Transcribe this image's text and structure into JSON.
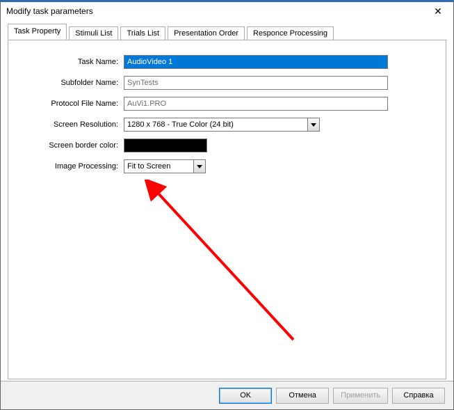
{
  "window": {
    "title": "Modify task parameters"
  },
  "tabs": {
    "items": [
      {
        "label": "Task Property"
      },
      {
        "label": "Stimuli List"
      },
      {
        "label": "Trials List"
      },
      {
        "label": "Presentation Order"
      },
      {
        "label": "Responce Processing"
      }
    ],
    "active_index": 0
  },
  "form": {
    "task_name": {
      "label": "Task Name:",
      "value": "AudioVideo 1"
    },
    "subfolder": {
      "label": "Subfolder Name:",
      "value": "SynTests"
    },
    "protocol": {
      "label": "Protocol File Name:",
      "value": "AuVi1.PRO"
    },
    "resolution": {
      "label": "Screen Resolution:",
      "value": "1280 x 768 - True Color (24 bit)"
    },
    "border_color": {
      "label": "Screen border color:",
      "value": "#000000"
    },
    "image_processing": {
      "label": "Image Processing:",
      "value": "Fit to Screen"
    }
  },
  "buttons": {
    "ok": "OK",
    "cancel": "Отмена",
    "apply": "Применить",
    "help": "Справка"
  }
}
